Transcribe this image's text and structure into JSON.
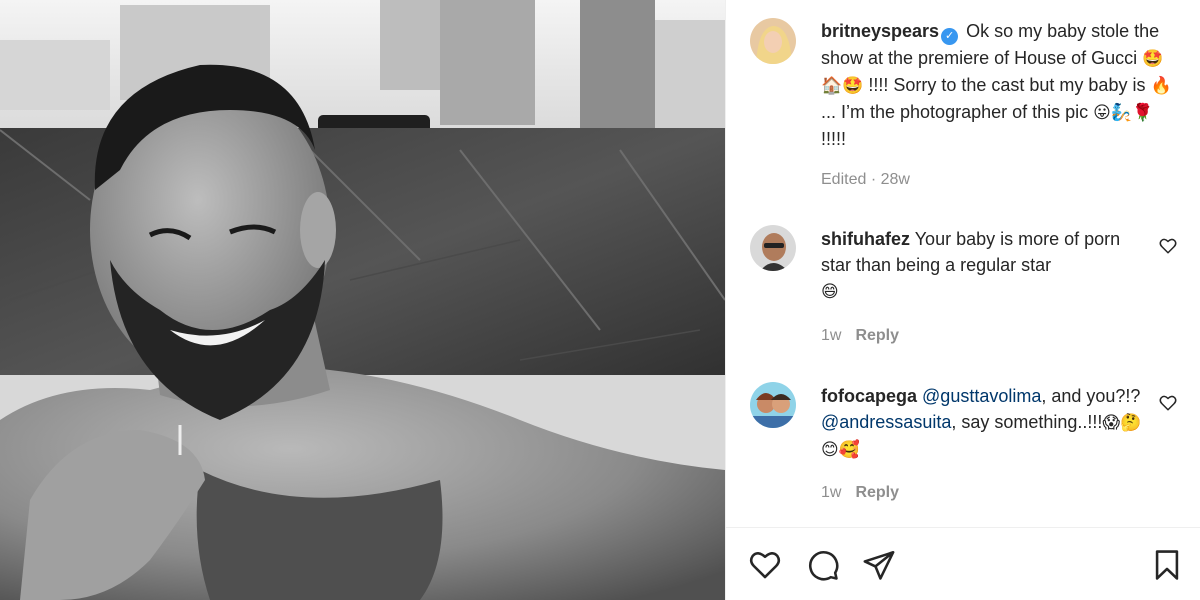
{
  "post": {
    "username": "britneyspears",
    "verified_badge": "✓",
    "caption_parts": [
      "Ok so my baby stole the show at the premiere of House of Gucci ",
      "🤩🏠🤩",
      " !!!! Sorry to the cast but my baby is ",
      "🔥",
      " ... I’m the photographer of this pic ",
      "😛🧞🌹",
      " !!!!!"
    ],
    "meta": "Edited · 28w"
  },
  "comments": [
    {
      "username": "shifuhafez",
      "text": "Your baby is more of porn star than being a regular star",
      "emoji": "😄",
      "time": "1w",
      "reply_label": "Reply"
    },
    {
      "username": "fofocapega",
      "mention1": "@gusttavolima",
      "text1": ", and you?!?",
      "mention2": "@andressasuita",
      "text2": ", say something..!!!",
      "emoji": "😱🤔😊🥰",
      "time": "1w",
      "reply_label": "Reply"
    }
  ],
  "icons": {
    "like": "heart-icon",
    "comment": "comment-icon",
    "share": "share-icon",
    "save": "bookmark-icon",
    "comment_like": "heart-icon"
  },
  "colors": {
    "text": "#262626",
    "muted": "#8e8e8e",
    "link": "#00376b",
    "verified": "#3897f0",
    "border": "#efefef"
  }
}
